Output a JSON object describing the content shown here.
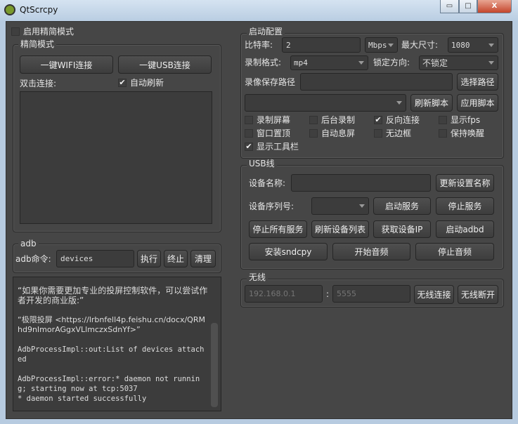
{
  "window": {
    "title": "QtScrcpy",
    "minimize": "▭",
    "maximize": "□",
    "close": "X"
  },
  "simple_mode": {
    "checkbox": "启用精简模式",
    "checked": false,
    "group_title": "精简模式",
    "wifi_button": "一键WIFI连接",
    "usb_button": "一键USB连接",
    "double_click_label": "双击连接:",
    "auto_refresh": "自动刷新",
    "auto_refresh_checked": true
  },
  "adb": {
    "group_title": "adb",
    "label": "adb命令:",
    "command": "devices",
    "execute": "执行",
    "terminate": "终止",
    "clear": "清理"
  },
  "log": [
    "“如果你需要更加专业的投屏控制软件，可以尝试作者开发的商业版:”",
    "“极限投屏 <https://lrbnfell4p.feishu.cn/docx/QRMhd9nImorAGgxVLlmczxSdnYf>”",
    "AdbProcessImpl::out:List of devices attached",
    "AdbProcessImpl::error:* daemon not running; starting now at tcp:5037\n* daemon started successfully"
  ],
  "startup": {
    "group_title": "启动配置",
    "bitrate_label": "比特率:",
    "bitrate": "2",
    "bitrate_unit": "Mbps",
    "max_size_label": "最大尺寸:",
    "max_size": "1080",
    "record_format_label": "录制格式:",
    "record_format": "mp4",
    "lock_orientation_label": "锁定方向:",
    "lock_orientation": "不锁定",
    "record_path_label": "录像保存路径",
    "record_path": "",
    "select_path": "选择路径",
    "script": "",
    "refresh_script": "刷新脚本",
    "apply_script": "应用脚本",
    "options": [
      {
        "label": "录制屏幕",
        "checked": false
      },
      {
        "label": "后台录制",
        "checked": false
      },
      {
        "label": "反向连接",
        "checked": true
      },
      {
        "label": "显示fps",
        "checked": false
      },
      {
        "label": "窗口置顶",
        "checked": false
      },
      {
        "label": "自动息屏",
        "checked": false
      },
      {
        "label": "无边框",
        "checked": false
      },
      {
        "label": "保持唤醒",
        "checked": false
      },
      {
        "label": "显示工具栏",
        "checked": true
      }
    ]
  },
  "usb": {
    "group_title": "USB线",
    "device_name_label": "设备名称:",
    "device_name": "",
    "update_name": "更新设置名称",
    "serial_label": "设备序列号:",
    "serial": "",
    "start_service": "启动服务",
    "stop_service": "停止服务",
    "stop_all": "停止所有服务",
    "refresh_devices": "刷新设备列表",
    "get_ip": "获取设备IP",
    "start_adbd": "启动adbd",
    "install_sndcpy": "安装sndcpy",
    "start_audio": "开始音频",
    "stop_audio": "停止音频"
  },
  "wireless": {
    "group_title": "无线",
    "ip_placeholder": "192.168.0.1",
    "separator": ":",
    "port_placeholder": "5555",
    "connect": "无线连接",
    "disconnect": "无线断开"
  }
}
